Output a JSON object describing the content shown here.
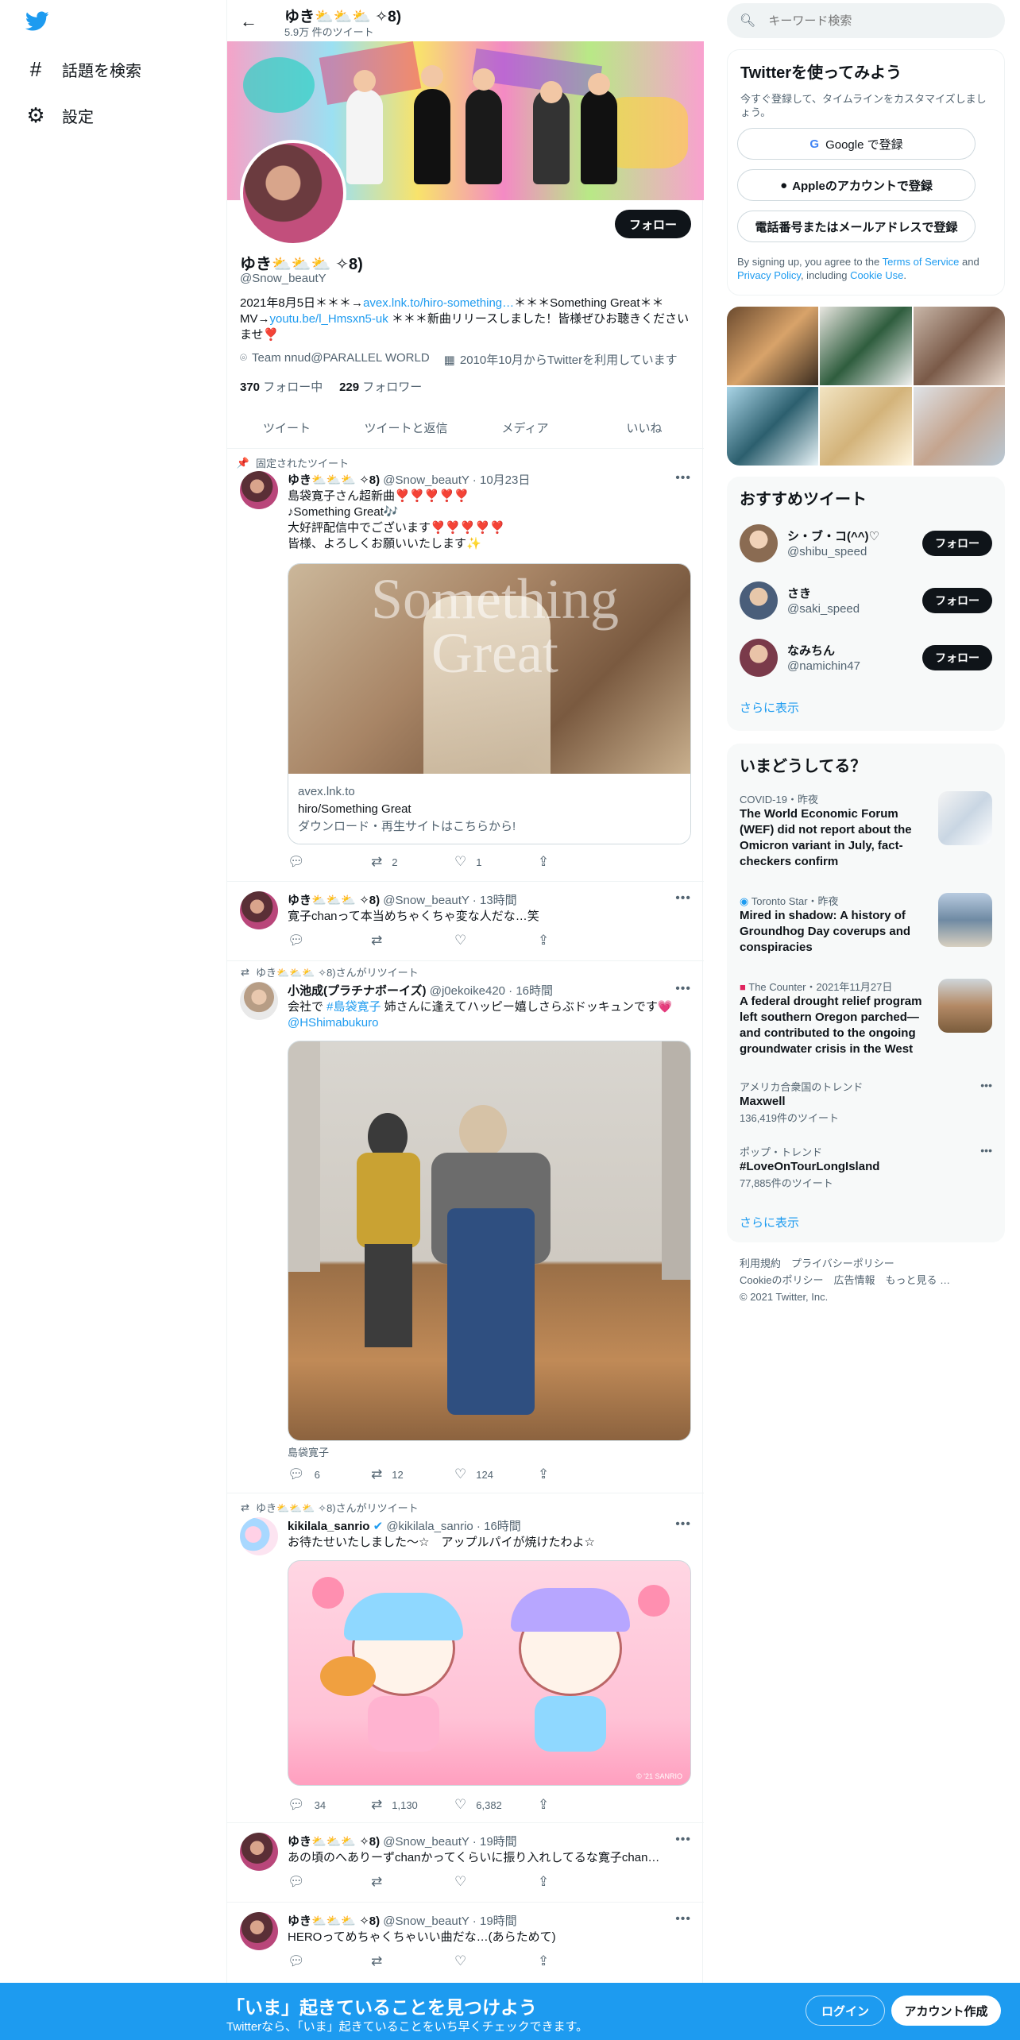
{
  "nav": {
    "items": [
      {
        "label": "話題を検索",
        "icon": "hashtag-icon"
      },
      {
        "label": "設定",
        "icon": "gear-icon"
      }
    ]
  },
  "profile": {
    "header_name": "ゆき⛅⛅⛅ ✧8)",
    "tweet_count": "5.9万 件のツイート",
    "name": "ゆき⛅⛅⛅ ✧8)",
    "handle": "@Snow_beautY",
    "follow_label": "フォロー",
    "bio_1": "2021年8月5日＊＊＊→",
    "bio_link1": "avex.lnk.to/hiro-something…",
    "bio_2": "＊＊＊Something Great＊＊MV→",
    "bio_link2": "youtu.be/l_Hmsxn5-uk",
    "bio_3": " ＊＊＊新曲リリースしました！皆様ぜひお聴きくださいませ❣️",
    "location": "Team nnud@PARALLEL WORLD",
    "joined": "2010年10月からTwitterを利用しています",
    "following_count": "370",
    "following_label": "フォロー中",
    "followers_count": "229",
    "followers_label": "フォロワー"
  },
  "tabs": [
    "ツイート",
    "ツイートと返信",
    "メディア",
    "いいね"
  ],
  "tweets": [
    {
      "context": "固定されたツイート",
      "name": "ゆき⛅⛅⛅ ✧8)",
      "meta": "@Snow_beautY · 10月23日",
      "text": "島袋寛子さん超新曲❣️❣️❣️❣️❣️\n♪Something Great🎶\n大好評配信中でございます❣️❣️❣️❣️❣️\n皆様、よろしくお願いいたします✨",
      "card_domain": "avex.lnk.to",
      "card_title": "hiro/Something Great",
      "card_desc": "ダウンロード・再生サイトはこちらから!",
      "card_image_text": "Something Great",
      "replies": "",
      "retweets": "2",
      "likes": "1"
    },
    {
      "name": "ゆき⛅⛅⛅ ✧8)",
      "meta": "@Snow_beautY · 13時間",
      "text": "寛子chanって本当めちゃくちゃ変な人だな…笑",
      "replies": "",
      "retweets": "",
      "likes": ""
    },
    {
      "context": "ゆき⛅⛅⛅ ✧8)さんがリツイート",
      "name": "小池成(プラチナボーイズ)",
      "meta": "@j0ekoike420 · 16時間",
      "text_1": "会社で ",
      "hashtag": "#島袋寛子",
      "text_2": " 姉さんに逢えてハッピー嬉しさらぶドッキュンです💗",
      "mention": "@HShimabukuro",
      "media_tag": "島袋寛子",
      "replies": "6",
      "retweets": "12",
      "likes": "124"
    },
    {
      "context": "ゆき⛅⛅⛅ ✧8)さんがリツイート",
      "name": "kikilala_sanrio",
      "meta": "@kikilala_sanrio · 16時間",
      "text": "お待たせいたしました〜☆　アップルパイが焼けたわよ☆",
      "image_caption": "© '21 SANRIO",
      "replies": "34",
      "retweets": "1,130",
      "likes": "6,382"
    },
    {
      "name": "ゆき⛅⛅⛅ ✧8)",
      "meta": "@Snow_beautY · 19時間",
      "text": "あの頃のへありーずchanかってくらいに振り入れしてるな寛子chan…",
      "replies": "",
      "retweets": "",
      "likes": ""
    },
    {
      "name": "ゆき⛅⛅⛅ ✧8)",
      "meta": "@Snow_beautY · 19時間",
      "text": "HEROってめちゃくちゃいい曲だな…(あらためて)",
      "replies": "",
      "retweets": "",
      "likes": ""
    }
  ],
  "right": {
    "search_placeholder": "キーワード検索",
    "signup": {
      "title": "Twitterを使ってみよう",
      "subtitle": "今すぐ登録して、タイムラインをカスタマイズしましょう。",
      "google": "Google で登録",
      "apple": "Appleのアカウントで登録",
      "phone": "電話番号またはメールアドレスで登録",
      "legal_1": "By signing up, you agree to the ",
      "legal_tos": "Terms of Service",
      "legal_2": " and ",
      "legal_privacy": "Privacy Policy",
      "legal_3": ", including ",
      "legal_cookie": "Cookie Use",
      "legal_4": "."
    },
    "who_to_follow": {
      "title": "おすすめツイート",
      "users": [
        {
          "name": "シ・ブ・コ(^^)♡",
          "handle": "@shibu_speed"
        },
        {
          "name": "さき",
          "handle": "@saki_speed"
        },
        {
          "name": "なみちん",
          "handle": "@namichin47"
        }
      ],
      "follow_label": "フォロー",
      "more": "さらに表示"
    },
    "trends": {
      "title": "いまどうしてる？",
      "items": [
        {
          "meta": "COVID-19・昨夜",
          "title": "The World Economic Forum (WEF) did not report about the Omicron variant in July, fact-checkers confirm"
        },
        {
          "meta": "Toronto Star・昨夜",
          "title": "Mired in shadow: A history of Groundhog Day coverups and conspiracies"
        },
        {
          "meta": "The Counter・2021年11月27日",
          "title": "A federal drought relief program left southern Oregon parched—and contributed to the ongoing groundwater crisis in the West"
        },
        {
          "meta": "アメリカ合衆国のトレンド",
          "title": "Maxwell",
          "count": "136,419件のツイート"
        },
        {
          "meta": "ポップ・トレンド",
          "title": "#LoveOnTourLongIsland",
          "count": "77,885件のツイート"
        }
      ],
      "more": "さらに表示"
    },
    "footer": {
      "line1": "利用規約　プライバシーポリシー",
      "line2": "Cookieのポリシー　広告情報　もっと見る …",
      "line3": "© 2021 Twitter, Inc."
    }
  },
  "bottom_bar": {
    "title": "「いま」起きていることを見つけよう",
    "subtitle": "Twitterなら、「いま」起きていることをいち早くチェックできます。",
    "login": "ログイン",
    "signup": "アカウント作成"
  },
  "colors": {
    "accent": "#1d9bf0",
    "text": "#0f1419",
    "muted": "#536471"
  }
}
